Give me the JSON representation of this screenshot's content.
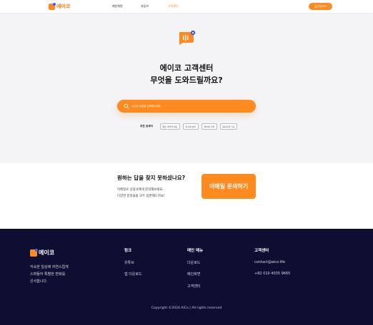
{
  "header": {
    "logo_text": "에이코",
    "nav": [
      {
        "label": "메인화면",
        "active": false
      },
      {
        "label": "유튜브",
        "active": false
      },
      {
        "label": "고객센터",
        "active": true
      }
    ],
    "download_button": "다운로드"
  },
  "hero": {
    "title_line1": "에이코 고객센터",
    "title_line2": "무엇을 도와드릴까요?"
  },
  "search": {
    "placeholder": "궁금한 내용을 입력해주세요.",
    "value": ""
  },
  "popular": {
    "label": "추천 검색어",
    "tags": [
      "앱은 어떻게 써요",
      "무서워 놀라",
      "쾌적해 가래",
      "탈퇴할래 가요"
    ]
  },
  "contact": {
    "title": "원하는 답을 찾지 못하셨나요?",
    "desc_line1": "이메일로 상담사에게 문의해보세요.",
    "desc_line2": "다양한 문의들을 모두 답변해드려요!",
    "email_button": "이메일 문의하기"
  },
  "footer": {
    "logo_text": "에이코",
    "tagline_line1": "익숙한 일상에 자연스럽게",
    "tagline_line2": "스며들어 특별한 변화를",
    "tagline_line3": "선사합니다.",
    "columns": [
      {
        "title": "링크",
        "items": [
          "유튜브",
          "앱 다운로드"
        ]
      },
      {
        "title": "메인 메뉴",
        "items": [
          "다운로드",
          "메인화면",
          "고객센터"
        ]
      },
      {
        "title": "고객센터",
        "items": [
          "contact@aico.life",
          "+82 010 4035 9665"
        ]
      }
    ],
    "copyright": "Copyright   ©2024 AiCo | All rights reserved"
  },
  "colors": {
    "accent": "#ff8a1f",
    "footer_bg": "#0e0e33",
    "page_bg": "#f4f4f6",
    "logo_dot": "#3b5bff"
  },
  "icons": [
    "logo-icon",
    "download-icon",
    "chat-bubble-icon",
    "search-icon"
  ]
}
